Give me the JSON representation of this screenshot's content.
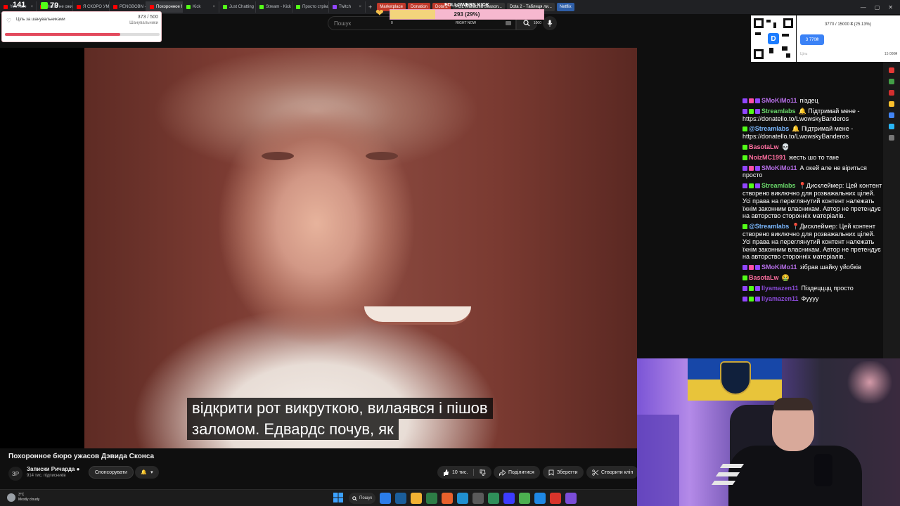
{
  "browser": {
    "tabs": [
      {
        "label": "YouTube",
        "color": "#ff0000"
      },
      {
        "label": "Никто не ожидал так...",
        "color": "#ff0000"
      },
      {
        "label": "Я СКОРО УМРУ. БУД...",
        "color": "#ff0000"
      },
      {
        "label": "PENGBOBN - YouTube",
        "color": "#ff0000"
      },
      {
        "label": "Похоронное бюр...",
        "color": "#ff0000",
        "active": true
      },
      {
        "label": "Kick",
        "color": "#53fc18"
      },
      {
        "label": "Just Chatting Stream...",
        "color": "#53fc18"
      },
      {
        "label": "Stream - Kick",
        "color": "#53fc18"
      },
      {
        "label": "Просто стрімлю з в...",
        "color": "#53fc18"
      },
      {
        "label": "Twitch",
        "color": "#9146ff"
      }
    ],
    "bookmarks": [
      {
        "label": "Marketplace",
        "color": "#c0392b"
      },
      {
        "label": "Donation",
        "color": "#c0392b"
      },
      {
        "label": "Dota 2",
        "color": "#c0392b"
      },
      {
        "label": "PGL Wallachia Season...",
        "color": "#333333"
      },
      {
        "label": "Dota 2 - Таблиця ли...",
        "color": "#333333"
      },
      {
        "label": "Netflix",
        "color": "#2f5fa8"
      }
    ],
    "new_tab": "+",
    "window_controls": [
      "—",
      "▢",
      "✕"
    ]
  },
  "youtube": {
    "search_placeholder": "Пошук",
    "video_title": "Похоронное бюро ужасов Дэвида Сконса",
    "channel": {
      "avatar_text": "ЗР",
      "name": "Записки Ричарда ●",
      "subscribers": "914 тис. підписників",
      "sponsor_label": "Спонсорувати",
      "bell": "🔔",
      "bell_caret": "▾"
    },
    "actions": {
      "likes": "10 тис.",
      "share": "Поділитися",
      "save": "Зберегти",
      "clip": "Створити кліп"
    },
    "subtitles": {
      "line1": "відкрити рот викруткою, вилаявся і пішов",
      "line2": "заломом. Едвардс почув, як"
    }
  },
  "overlay": {
    "viewers": "141",
    "kick_count": "79",
    "follower_goal": {
      "label": "Ціль за шанувальниками",
      "count": "373 / 500",
      "sub": "Шанувальники",
      "progress": 0.746
    },
    "followers_kick": {
      "title": "FOLLOWERS KICK",
      "value": "293 (29%)",
      "min": "0",
      "max": "1000",
      "now_label": "RIGHT NOW",
      "progress": 0.293
    },
    "donation": {
      "title": "3770 / 15000 ₴ (25.13%)",
      "button": "3 770₴",
      "min_label": "Ціль",
      "max_label": "15 000₴"
    }
  },
  "chat": [
    {
      "badges": [
        "#9146ff",
        "#ff4fa3",
        "#9146ff"
      ],
      "user": "SMoKiMo11",
      "cls": "u-purple",
      "text": "піздец"
    },
    {
      "badges": [
        "#9146ff",
        "#53fc18",
        "#9146ff"
      ],
      "user": "Streamlabs",
      "cls": "u-green",
      "text": "🔔 Підтримай мене - https://donatello.to/LwowskyBanderos"
    },
    {
      "badges": [
        "#53fc18"
      ],
      "user": "@Streamlabs",
      "cls": "u-blue",
      "text": "🔔 Підтримай мене - https://donatello.to/LwowskyBanderos"
    },
    {
      "badges": [
        "#53fc18"
      ],
      "user": "BasotaLw",
      "cls": "u-pink",
      "text": "💀"
    },
    {
      "badges": [
        "#53fc18"
      ],
      "user": "NoizMC1991",
      "cls": "u-pink",
      "text": "жесть шо то таке"
    },
    {
      "badges": [
        "#9146ff",
        "#ff4fa3",
        "#9146ff"
      ],
      "user": "SMoKiMo11",
      "cls": "u-purple",
      "text": "А окей але не віриться просто"
    },
    {
      "badges": [
        "#9146ff",
        "#53fc18",
        "#9146ff"
      ],
      "user": "Streamlabs",
      "cls": "u-green",
      "text": "📍Дисклеймер: Цей контент створено виключно для розважальних цілей. Усі права на переглянутий контент належать їхнім законним власникам. Автор не претендує на авторство сторонніх матеріалів."
    },
    {
      "badges": [
        "#53fc18"
      ],
      "user": "@Streamlabs",
      "cls": "u-blue",
      "text": "📍Дисклеймер: Цей контент створено виключно для розважальних цілей. Усі права на переглянутий контент належать їхнім законним власникам. Автор не претендує на авторство сторонніх матеріалів."
    },
    {
      "badges": [
        "#9146ff",
        "#ff4fa3",
        "#9146ff"
      ],
      "user": "SMoKiMo11",
      "cls": "u-purple",
      "text": "зібрав шайку уйобків"
    },
    {
      "badges": [
        "#53fc18"
      ],
      "user": "BasotaLw",
      "cls": "u-pink",
      "text": "🤮"
    },
    {
      "badges": [
        "#9146ff",
        "#53fc18",
        "#9146ff"
      ],
      "user": "Ilyamazen11",
      "cls": "u-violet",
      "text": "Піздецццц просто"
    },
    {
      "badges": [
        "#9146ff",
        "#53fc18",
        "#9146ff"
      ],
      "user": "Ilyamazen11",
      "cls": "u-violet",
      "text": "Фуууу"
    }
  ],
  "taskbar": {
    "weather_temp": "3°C",
    "weather_desc": "Mostly cloudy",
    "search_label": "Пошук",
    "icons": [
      "#2b7de9",
      "#1b5e9b",
      "#f2b233",
      "#2d7d46",
      "#e8612c",
      "#2090d0",
      "#5a5a5a",
      "#2f8f5a",
      "#3c3cff",
      "#4caf50",
      "#1e88e5",
      "#d9342b",
      "#7b4dd8"
    ]
  }
}
